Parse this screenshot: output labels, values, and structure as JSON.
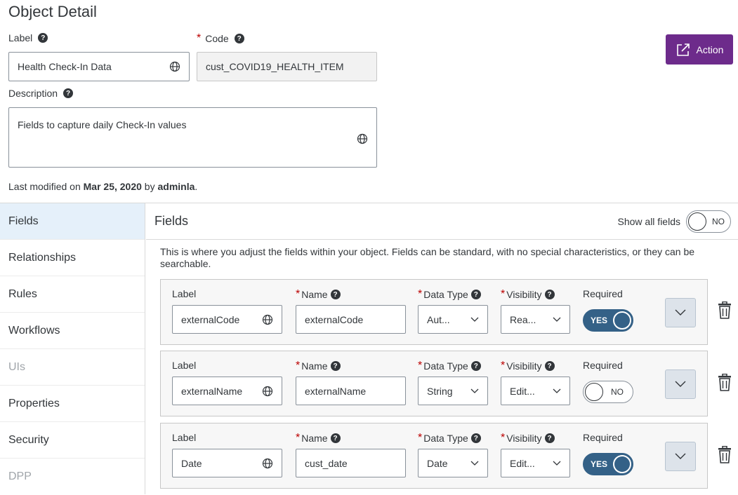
{
  "header": {
    "title": "Object Detail",
    "action_label": "Action"
  },
  "form": {
    "label_title": "Label",
    "label_value": "Health Check-In Data",
    "code_title": "Code",
    "code_value": "cust_COVID19_HEALTH_ITEM",
    "description_title": "Description",
    "description_value": "Fields to capture daily Check-In values",
    "modified_prefix": "Last modified on ",
    "modified_date": "Mar 25, 2020",
    "modified_by_prefix": " by ",
    "modified_user": "adminla",
    "modified_suffix": "."
  },
  "sidebar": {
    "items": [
      {
        "label": "Fields",
        "active": true
      },
      {
        "label": "Relationships"
      },
      {
        "label": "Rules"
      },
      {
        "label": "Workflows"
      },
      {
        "label": "UIs",
        "disabled": true
      },
      {
        "label": "Properties"
      },
      {
        "label": "Security"
      },
      {
        "label": "DPP",
        "disabled": true
      }
    ]
  },
  "fields": {
    "title": "Fields",
    "show_all_label": "Show all fields",
    "show_all_toggle": "NO",
    "description": "This is where you adjust the fields within your object. Fields can be standard, with no special characteristics, or they can be searchable.",
    "col_label": "Label",
    "col_name": "Name",
    "col_type": "Data Type",
    "col_visibility": "Visibility",
    "col_required": "Required",
    "rows": [
      {
        "label": "externalCode",
        "name": "externalCode",
        "type": "Aut...",
        "visibility": "Rea...",
        "required": "YES"
      },
      {
        "label": "externalName",
        "name": "externalName",
        "type": "String",
        "visibility": "Edit...",
        "required": "NO"
      },
      {
        "label": "Date",
        "name": "cust_date",
        "type": "Date",
        "visibility": "Edit...",
        "required": "YES"
      }
    ]
  },
  "colors": {
    "accent": "#6d2b8b",
    "toggle_on": "#346187",
    "active_nav": "#e5f0fa"
  }
}
